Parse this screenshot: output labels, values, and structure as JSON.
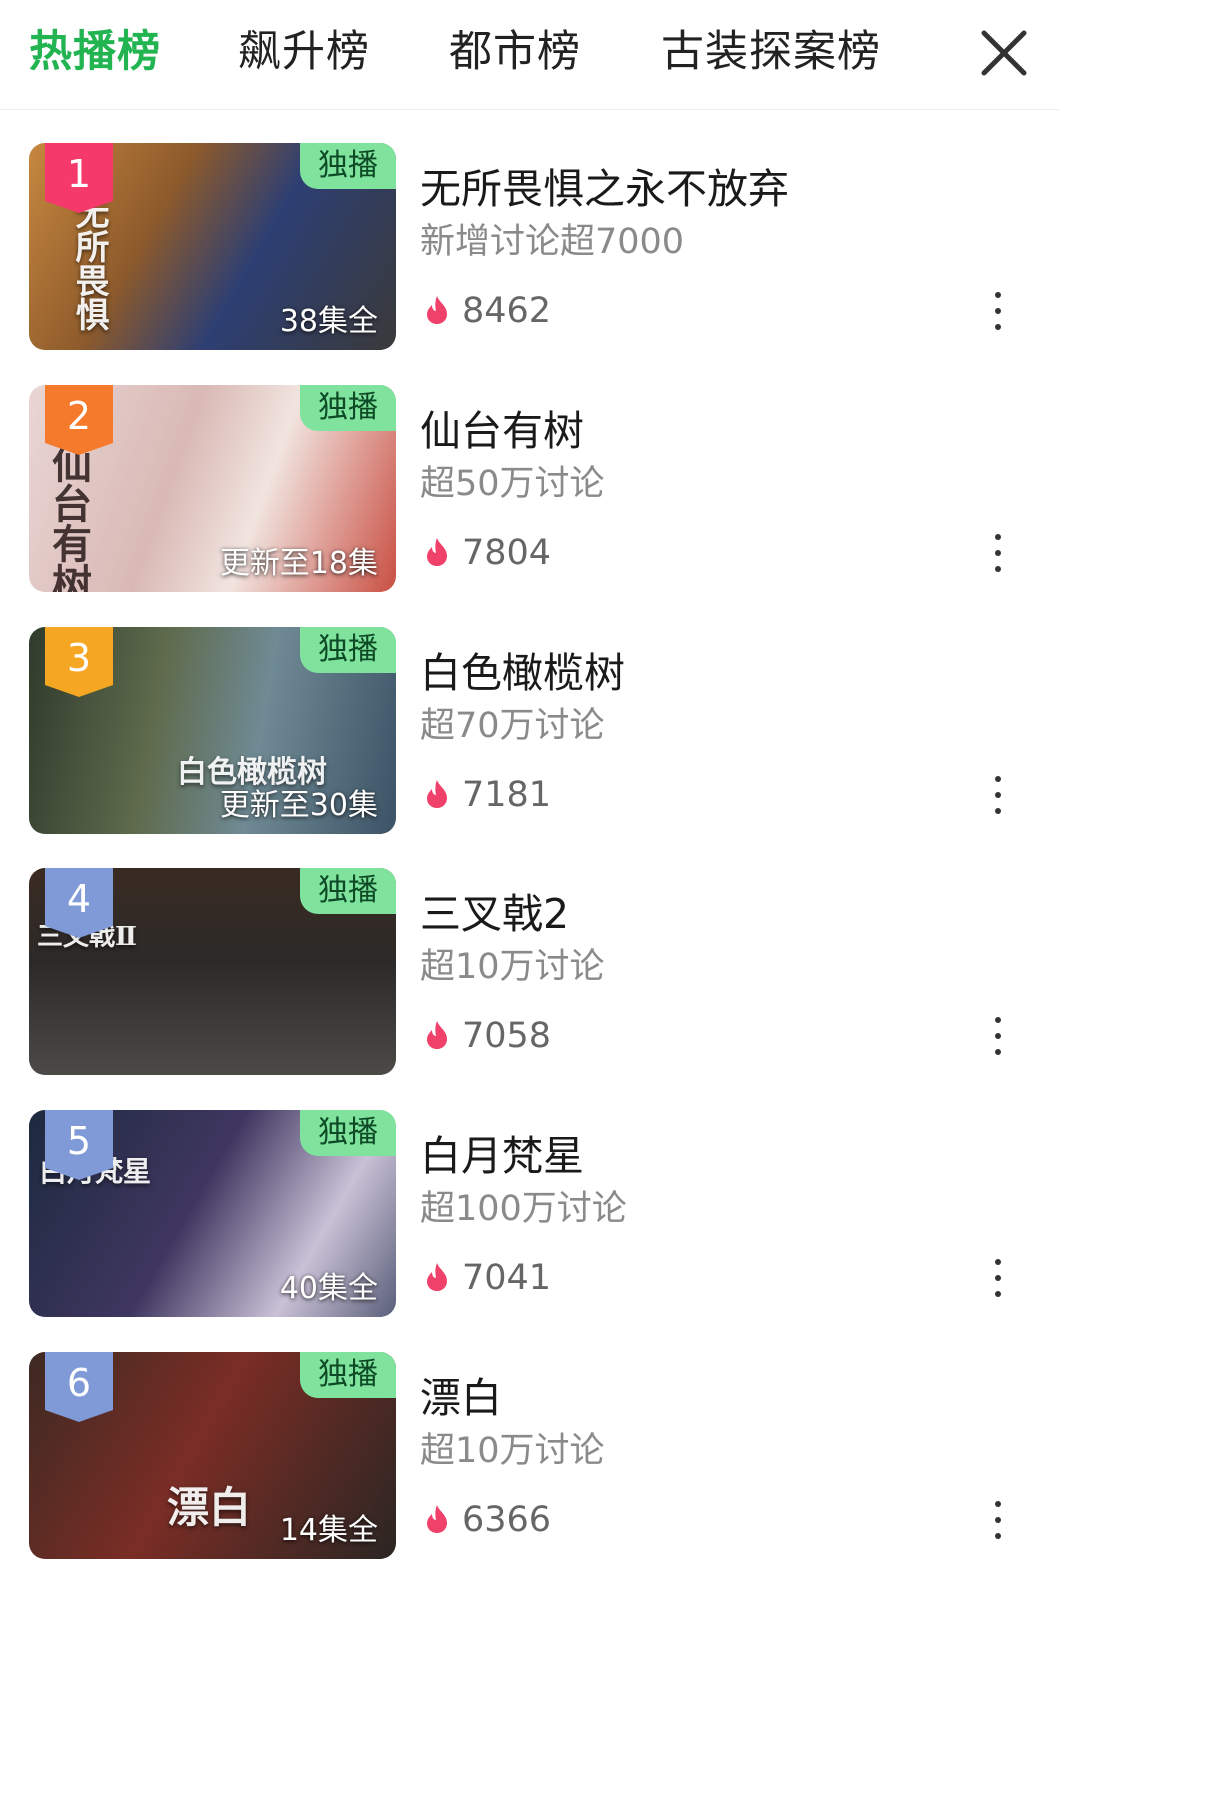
{
  "tabs": [
    {
      "label": "热播榜",
      "active": true
    },
    {
      "label": "飙升榜",
      "active": false
    },
    {
      "label": "都市榜",
      "active": false
    },
    {
      "label": "古装探案榜",
      "active": false
    }
  ],
  "close_icon": "close-icon",
  "exclusive_label": "独播",
  "colors": {
    "accent": "#21b451",
    "exclusive_bg": "#7fe39e",
    "heat": "#f0416a",
    "rank_1": "#f5396b",
    "rank_2": "#f57a2c",
    "rank_3": "#f5a623",
    "rank_other": "#7f9ad6"
  },
  "items": [
    {
      "rank": "1",
      "title": "无所畏惧之永不放弃",
      "subtitle": "新增讨论超7000",
      "heat": "8462",
      "episodes": "38集全",
      "poster_title": "无所畏惧"
    },
    {
      "rank": "2",
      "title": "仙台有树",
      "subtitle": "超50万讨论",
      "heat": "7804",
      "episodes": "更新至18集",
      "poster_title": "仙台有树"
    },
    {
      "rank": "3",
      "title": "白色橄榄树",
      "subtitle": "超70万讨论",
      "heat": "7181",
      "episodes": "更新至30集",
      "poster_title": "白色橄榄树"
    },
    {
      "rank": "4",
      "title": "三叉戟2",
      "subtitle": "超10万讨论",
      "heat": "7058",
      "episodes": "",
      "poster_title": "三叉戟Ⅱ"
    },
    {
      "rank": "5",
      "title": "白月梵星",
      "subtitle": "超100万讨论",
      "heat": "7041",
      "episodes": "40集全",
      "poster_title": "白月梵星"
    },
    {
      "rank": "6",
      "title": "漂白",
      "subtitle": "超10万讨论",
      "heat": "6366",
      "episodes": "14集全",
      "poster_title": "漂白"
    }
  ]
}
